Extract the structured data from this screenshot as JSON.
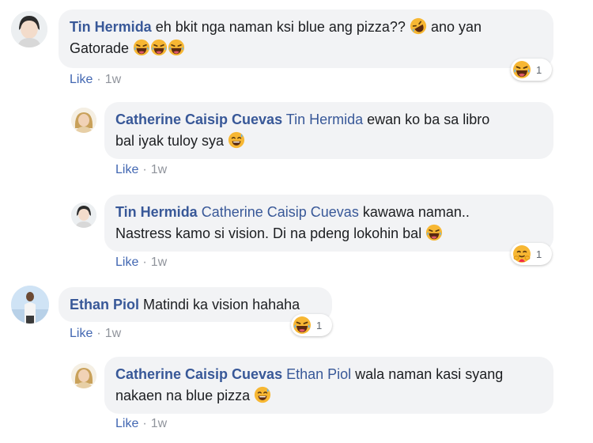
{
  "comments": [
    {
      "author": "Tin Hermida",
      "text_1": "eh bkit nga naman ksi blue ang pizza??",
      "text_2": "ano yan",
      "text_3": "Gatorade",
      "like": "Like",
      "time": "1w",
      "reaction_count": "1"
    },
    {
      "author": "Catherine Caisip Cuevas",
      "mention": "Tin Hermida",
      "text_1": "ewan ko ba sa libro",
      "text_2": "bal iyak tuloy sya",
      "like": "Like",
      "time": "1w"
    },
    {
      "author": "Tin Hermida",
      "mention": "Catherine Caisip Cuevas",
      "text_1": "kawawa naman..",
      "text_2": "Nastress kamo si vision. Di na pdeng lokohin bal",
      "like": "Like",
      "time": "1w",
      "reaction_count": "1"
    },
    {
      "author": "Ethan Piol",
      "text_1": "Matindi ka vision hahaha",
      "like": "Like",
      "time": "1w",
      "reaction_count": "1"
    },
    {
      "author": "Catherine Caisip Cuevas",
      "mention": "Ethan Piol",
      "text_1": "wala naman kasi syang",
      "text_2": "nakaen na blue pizza",
      "like": "Like",
      "time": "1w"
    }
  ],
  "colors": {
    "author": "#385898",
    "like": "#4267b2",
    "meta": "#90949c",
    "bubble": "#f2f3f5",
    "emoji_face": "#f7b733"
  },
  "icons": {
    "laughing": "tears-of-joy-emoji",
    "rofl": "rolling-on-floor-laughing-emoji",
    "sweat_smile": "sweat-smile-emoji",
    "haha_reaction": "haha-reaction-icon",
    "care_reaction": "care-reaction-icon"
  }
}
